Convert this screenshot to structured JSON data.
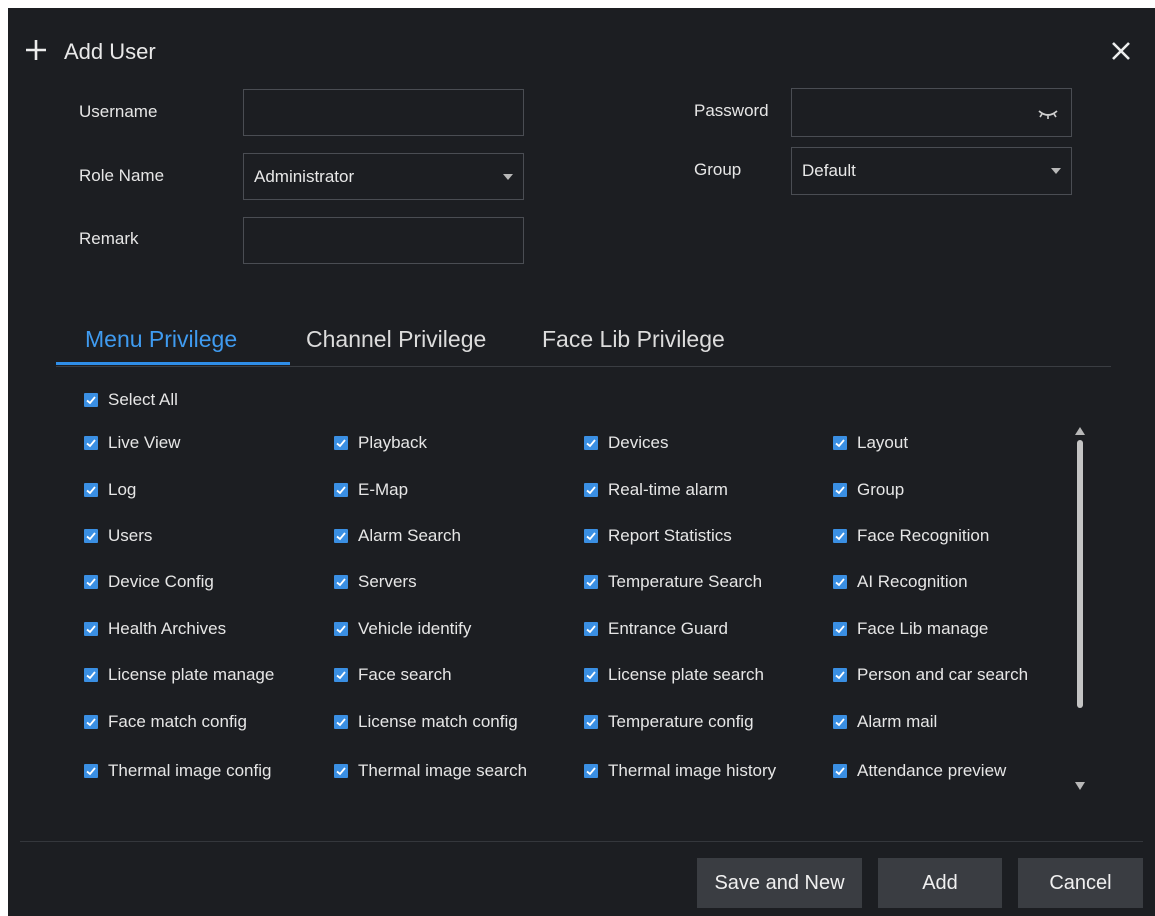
{
  "dialog": {
    "title": "Add User",
    "icons": {
      "title": "plus-icon",
      "close": "close-icon",
      "password_toggle": "eye-closed-icon",
      "dropdown": "chevron-down-icon",
      "checkbox": "checkmark-icon"
    }
  },
  "form": {
    "username_label": "Username",
    "username_value": "",
    "password_label": "Password",
    "password_value": "",
    "role_label": "Role Name",
    "role_value": "Administrator",
    "group_label": "Group",
    "group_value": "Default",
    "remark_label": "Remark",
    "remark_value": ""
  },
  "tabs": [
    {
      "label": "Menu Privilege",
      "active": true
    },
    {
      "label": "Channel Privilege",
      "active": false
    },
    {
      "label": "Face Lib Privilege",
      "active": false
    }
  ],
  "privileges": {
    "select_all_label": "Select All",
    "select_all_checked": true,
    "items": [
      {
        "label": "Live View",
        "checked": true
      },
      {
        "label": "Playback",
        "checked": true
      },
      {
        "label": "Devices",
        "checked": true
      },
      {
        "label": "Layout",
        "checked": true
      },
      {
        "label": "Log",
        "checked": true
      },
      {
        "label": "E-Map",
        "checked": true
      },
      {
        "label": "Real-time alarm",
        "checked": true
      },
      {
        "label": "Group",
        "checked": true
      },
      {
        "label": "Users",
        "checked": true
      },
      {
        "label": "Alarm Search",
        "checked": true
      },
      {
        "label": "Report Statistics",
        "checked": true
      },
      {
        "label": "Face Recognition",
        "checked": true
      },
      {
        "label": "Device Config",
        "checked": true
      },
      {
        "label": "Servers",
        "checked": true
      },
      {
        "label": "Temperature Search",
        "checked": true
      },
      {
        "label": "AI Recognition",
        "checked": true
      },
      {
        "label": "Health Archives",
        "checked": true
      },
      {
        "label": "Vehicle identify",
        "checked": true
      },
      {
        "label": "Entrance Guard",
        "checked": true
      },
      {
        "label": "Face Lib manage",
        "checked": true
      },
      {
        "label": "License plate manage",
        "checked": true
      },
      {
        "label": "Face search",
        "checked": true
      },
      {
        "label": "License plate search",
        "checked": true
      },
      {
        "label": "Person and car search",
        "checked": true
      },
      {
        "label": "Face match config",
        "checked": true
      },
      {
        "label": "License match config",
        "checked": true
      },
      {
        "label": "Temperature config",
        "checked": true
      },
      {
        "label": "Alarm mail",
        "checked": true
      },
      {
        "label": "Thermal image config",
        "checked": true
      },
      {
        "label": "Thermal image search",
        "checked": true
      },
      {
        "label": "Thermal image history",
        "checked": true
      },
      {
        "label": "Attendance preview",
        "checked": true
      }
    ]
  },
  "footer": {
    "save_and_new_label": "Save and New",
    "add_label": "Add",
    "cancel_label": "Cancel"
  },
  "colors": {
    "background": "#1c1e22",
    "accent": "#3f9bf0",
    "checkbox": "#3a8fe3",
    "button": "#3a3d42"
  }
}
